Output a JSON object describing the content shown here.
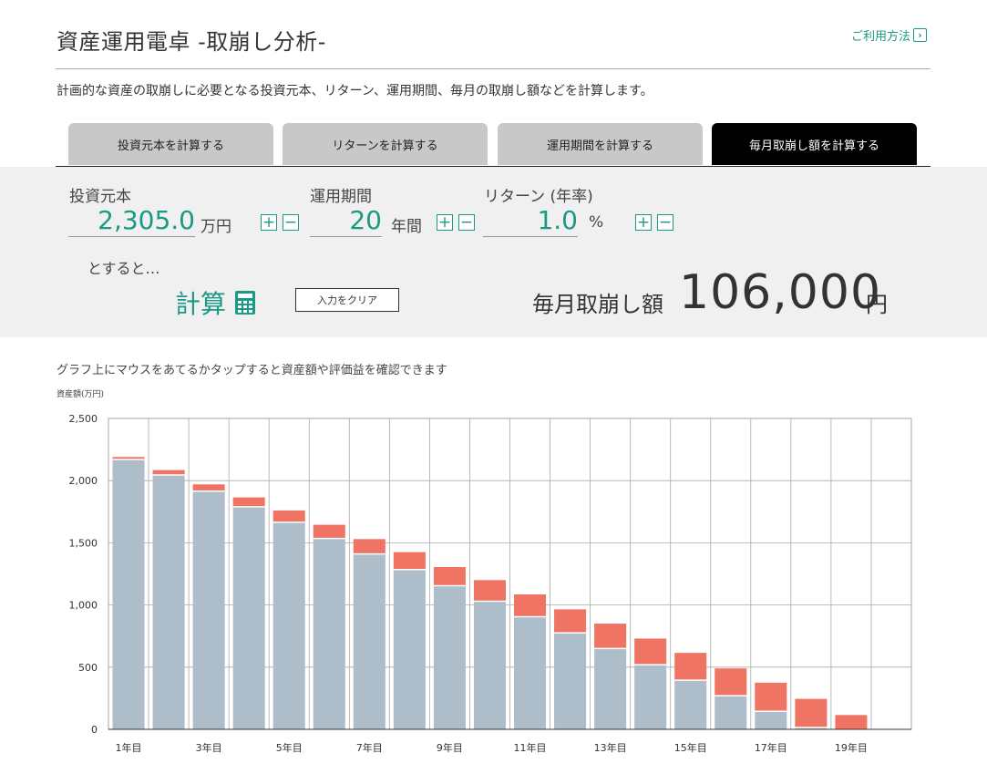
{
  "header": {
    "title": "資産運用電卓 -取崩し分析-",
    "howto_label": "ご利用方法",
    "description": "計画的な資産の取崩しに必要となる投資元本、リターン、運用期間、毎月の取崩し額などを計算します。"
  },
  "tabs": [
    {
      "label": "投資元本を計算する",
      "active": false
    },
    {
      "label": "リターンを計算する",
      "active": false
    },
    {
      "label": "運用期間を計算する",
      "active": false
    },
    {
      "label": "毎月取崩し額を計算する",
      "active": true
    }
  ],
  "inputs": {
    "principal": {
      "label": "投資元本",
      "value": "2,305.0",
      "unit": "万円"
    },
    "period": {
      "label": "運用期間",
      "value": "20",
      "unit": "年間"
    },
    "return": {
      "label": "リターン (年率)",
      "value": "1.0",
      "unit": "%"
    },
    "plus": "+",
    "minus": "−"
  },
  "then_label": "とすると…",
  "calc_label": "計算",
  "clear_label": "入力をクリア",
  "result": {
    "label": "毎月取崩し額",
    "value": "106,000",
    "unit": "円"
  },
  "chart_hint": "グラフ上にマウスをあてるかタップすると資産額や評価益を確認できます",
  "colors": {
    "accent": "#1a9a86",
    "principal_bar": "#adbdca",
    "gain_bar": "#ef7464"
  },
  "chart_data": {
    "type": "bar",
    "stacked": true,
    "ylabel": "資産額(万円)",
    "ylim": [
      0,
      2500
    ],
    "yticks": [
      0,
      500,
      1000,
      1500,
      2000,
      2500
    ],
    "ytick_labels": [
      "0",
      "500",
      "1,000",
      "1,500",
      "2,000",
      "2,500"
    ],
    "categories": [
      "1年目",
      "2年目",
      "3年目",
      "4年目",
      "5年目",
      "6年目",
      "7年目",
      "8年目",
      "9年目",
      "10年目",
      "11年目",
      "12年目",
      "13年目",
      "14年目",
      "15年目",
      "16年目",
      "17年目",
      "18年目",
      "19年目",
      "20年目"
    ],
    "xtick_labels": [
      "1年目",
      "",
      "3年目",
      "",
      "5年目",
      "",
      "7年目",
      "",
      "9年目",
      "",
      "11年目",
      "",
      "13年目",
      "",
      "15年目",
      "",
      "17年目",
      "",
      "19年目",
      ""
    ],
    "series": [
      {
        "values": [
          2170,
          2045,
          1915,
          1790,
          1665,
          1535,
          1410,
          1285,
          1155,
          1030,
          905,
          775,
          650,
          520,
          395,
          270,
          145,
          15,
          0,
          0
        ]
      },
      {
        "values": [
          20,
          40,
          55,
          75,
          95,
          110,
          120,
          140,
          150,
          170,
          180,
          190,
          200,
          210,
          220,
          220,
          230,
          230,
          115,
          0
        ]
      }
    ],
    "grid": true
  }
}
